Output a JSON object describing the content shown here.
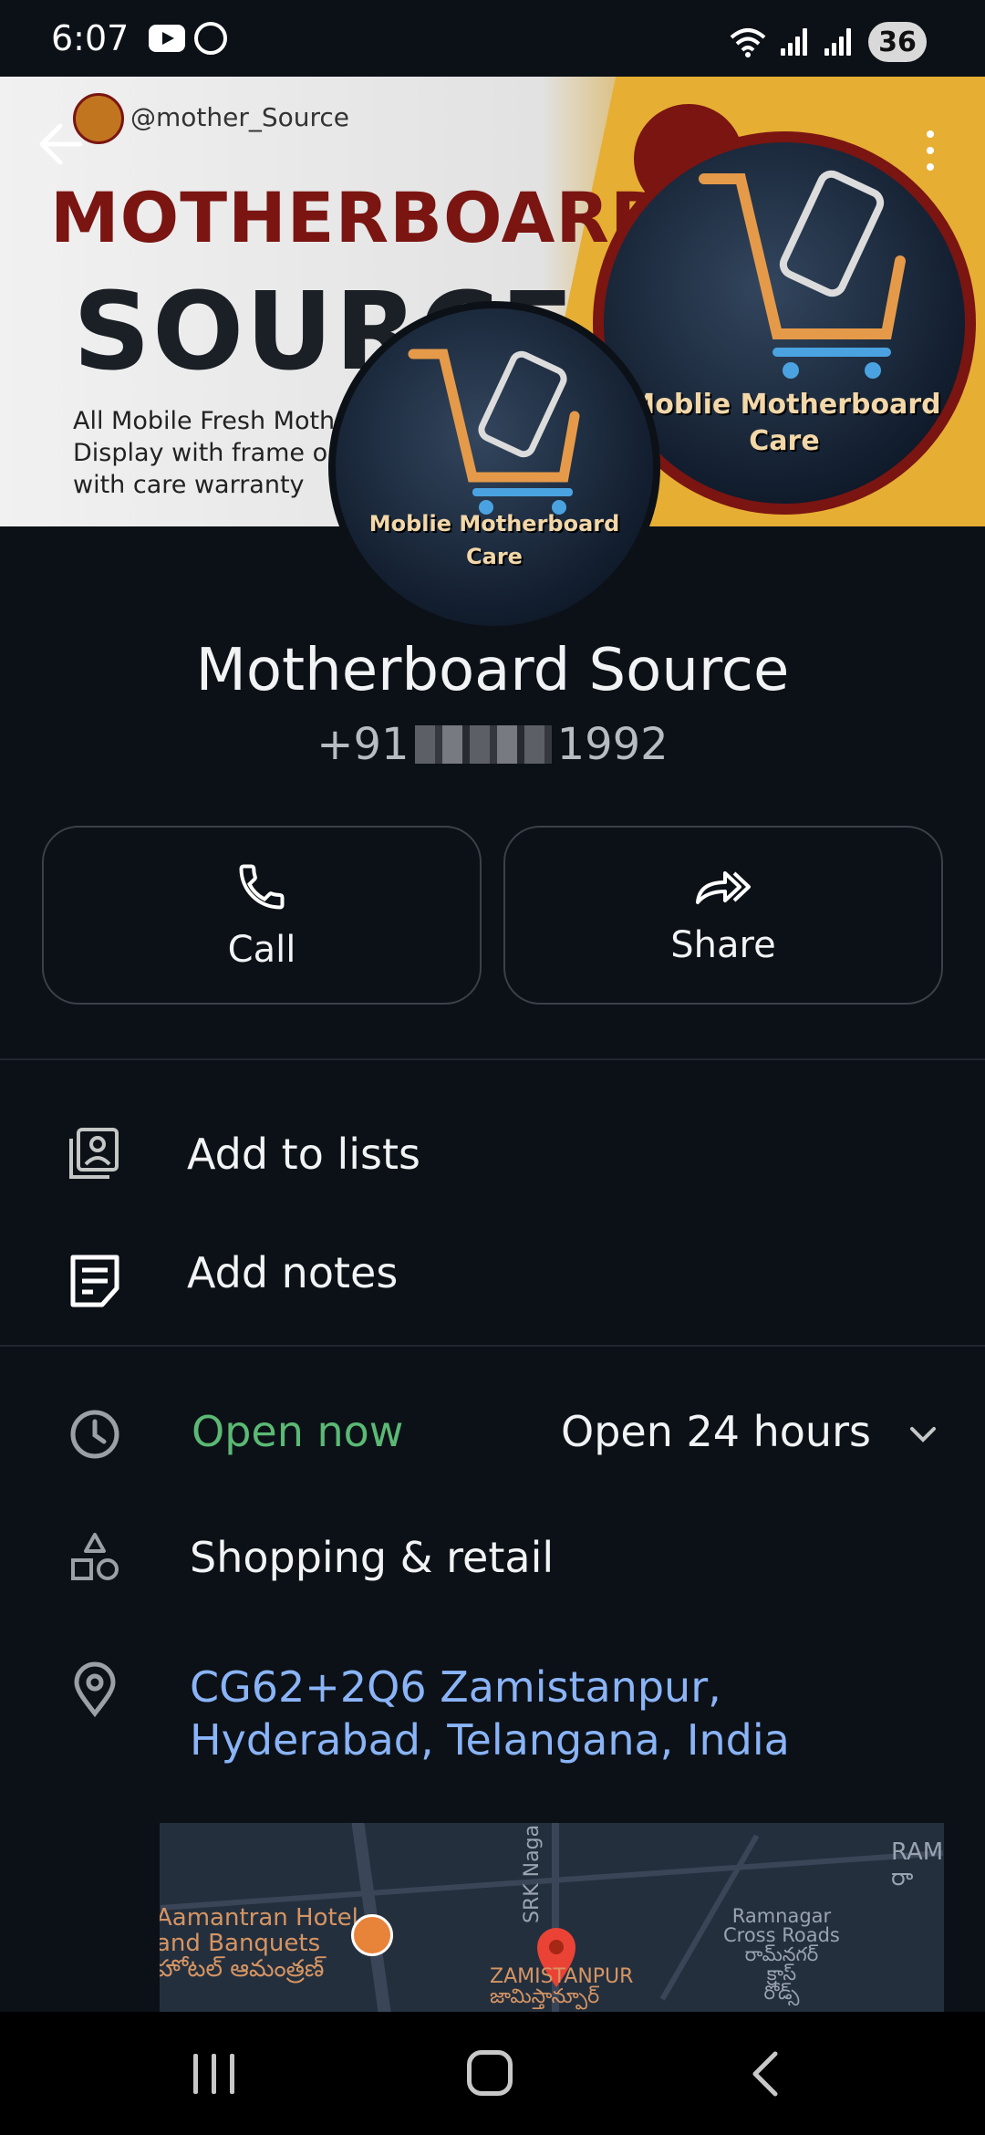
{
  "status_bar": {
    "time": "6:07",
    "battery": "36"
  },
  "banner": {
    "handle": "@mother_Source",
    "title_line1": "MOTHERBOARD",
    "title_line2": "SOURCE",
    "subtitle": "All Mobile Fresh Moth\nDisplay with frame or\nwith care warranty",
    "logo_label_line1": "Moblie Motherboard",
    "logo_label_line2": "Care"
  },
  "avatar": {
    "label_line1": "Moblie Motherboard",
    "label_line2": "Care"
  },
  "place": {
    "name": "Motherboard Source",
    "phone_prefix": "+91",
    "phone_suffix": "1992"
  },
  "actions": {
    "call_label": "Call",
    "share_label": "Share"
  },
  "list_actions": {
    "add_to_lists": "Add to lists",
    "add_notes": "Add notes"
  },
  "details": {
    "open_status": "Open now",
    "hours": "Open 24 hours",
    "category": "Shopping & retail",
    "address": "CG62+2Q6 Zamistanpur, Hyderabad, Telangana, India"
  },
  "map": {
    "label_hotel": "Aamantran Hotel\nand Banquets\nహోటల్ ఆమంత్రణ్",
    "label_road": "SRK Nagar",
    "label_area": "ZAMISTANPUR\nజామిస్తాన్పూర్",
    "label_crossroads": "Ramnagar\nCross Roads\nరామ్‌నగర్\nక్రాస్\nరోడ్స్",
    "label_corner": "RAM\nరా"
  },
  "colors": {
    "background": "#0c1117",
    "open_green": "#5bb974",
    "link_blue": "#8ab4f8",
    "banner_maroon": "#7a1512",
    "banner_gold": "#e6ae33"
  }
}
